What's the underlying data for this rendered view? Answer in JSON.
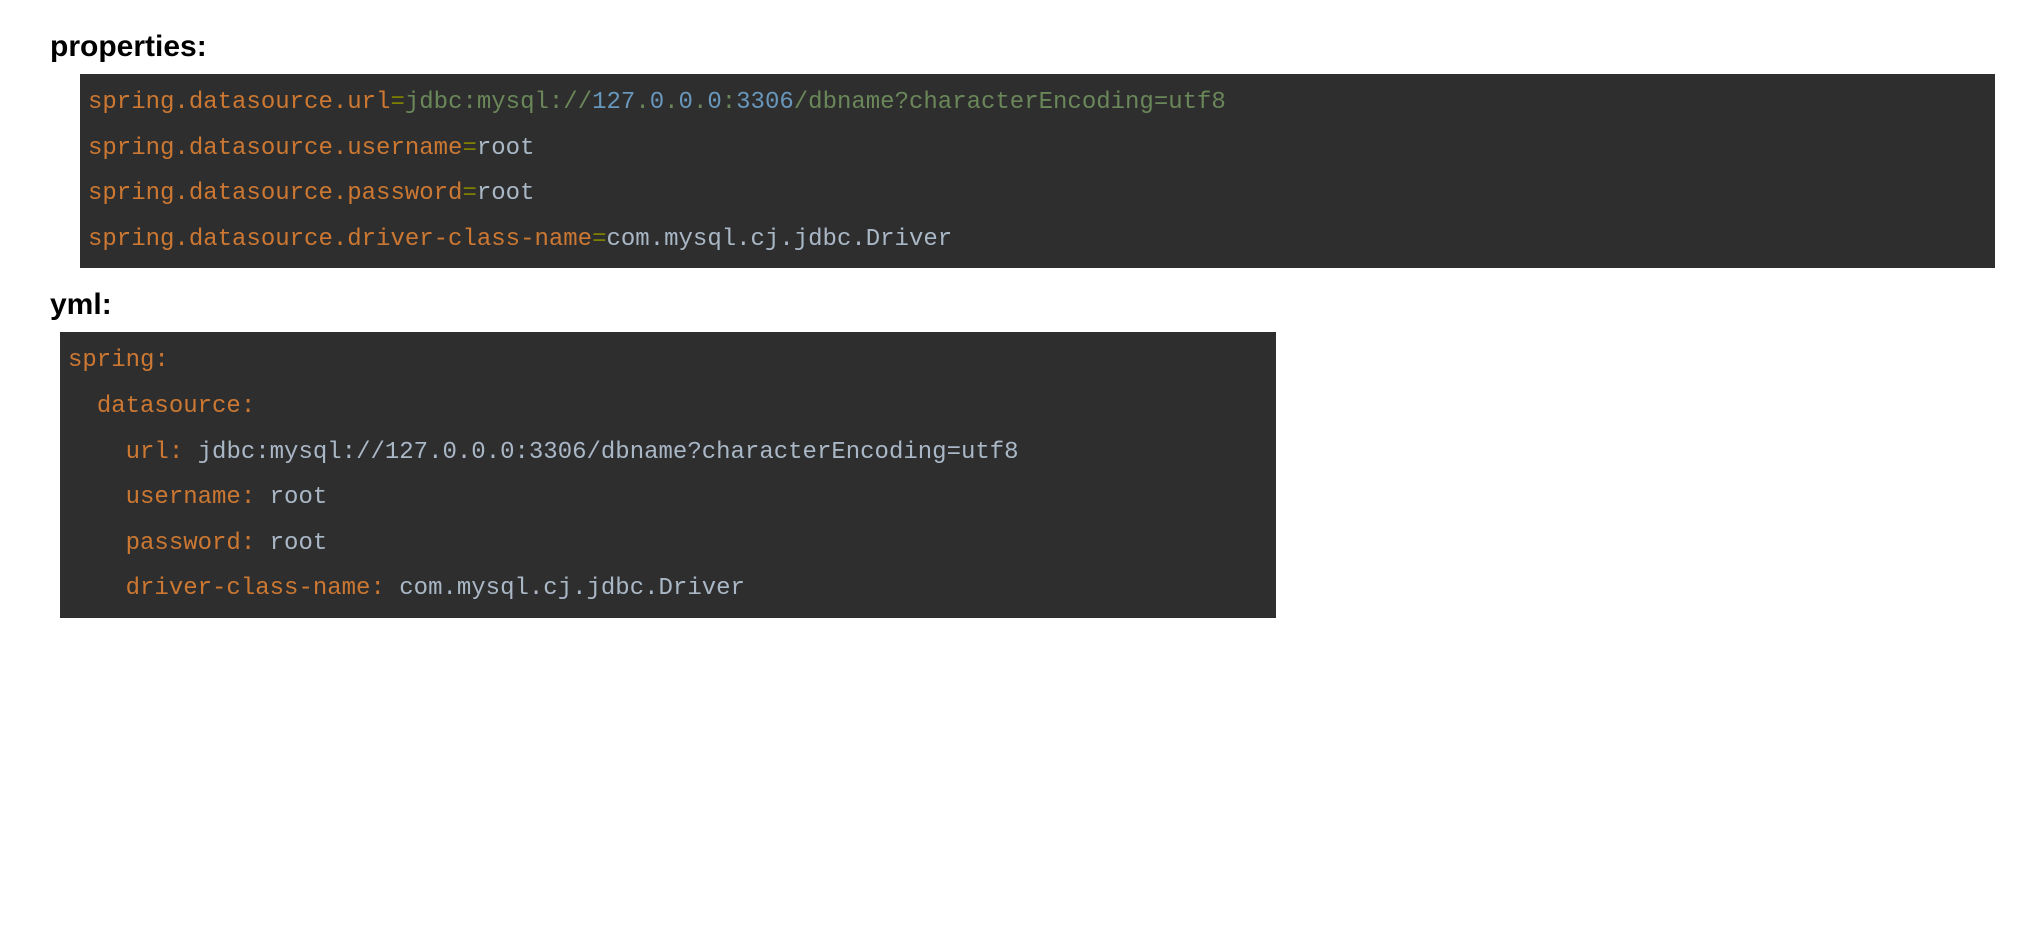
{
  "headings": {
    "properties": "properties:",
    "yml": "yml:"
  },
  "properties": {
    "line1": {
      "key": "spring.datasource.url",
      "eq": "=",
      "val_prefix": "jdbc:mysql://",
      "val_ip_a": "127",
      "val_dot1": ".",
      "val_ip_b": "0",
      "val_dot2": ".",
      "val_ip_c": "0",
      "val_dot3": ".",
      "val_ip_d": "0",
      "val_colon": ":",
      "val_port": "3306",
      "val_rest": "/dbname?characterEncoding=utf8"
    },
    "line2": {
      "key": "spring.datasource.username",
      "eq": "=",
      "val": "root"
    },
    "line3": {
      "key": "spring.datasource.password",
      "eq": "=",
      "val": "root"
    },
    "line4": {
      "key": "spring.datasource.driver-class-name",
      "eq": "=",
      "val": "com.mysql.cj.jdbc.Driver"
    }
  },
  "yml": {
    "line1": {
      "key": "spring",
      "colon": ":"
    },
    "line2": {
      "indent": "  ",
      "key": "datasource",
      "colon": ":"
    },
    "line3": {
      "indent": "    ",
      "key": "url",
      "colon": ": ",
      "val": "jdbc:mysql://127.0.0.0:3306/dbname?characterEncoding=utf8"
    },
    "line4": {
      "indent": "    ",
      "key": "username",
      "colon": ": ",
      "val": "root"
    },
    "line5": {
      "indent": "    ",
      "key": "password",
      "colon": ": ",
      "val": "root"
    },
    "line6": {
      "indent": "    ",
      "key": "driver-class-name",
      "colon": ": ",
      "val": "com.mysql.cj.jdbc.Driver"
    }
  }
}
